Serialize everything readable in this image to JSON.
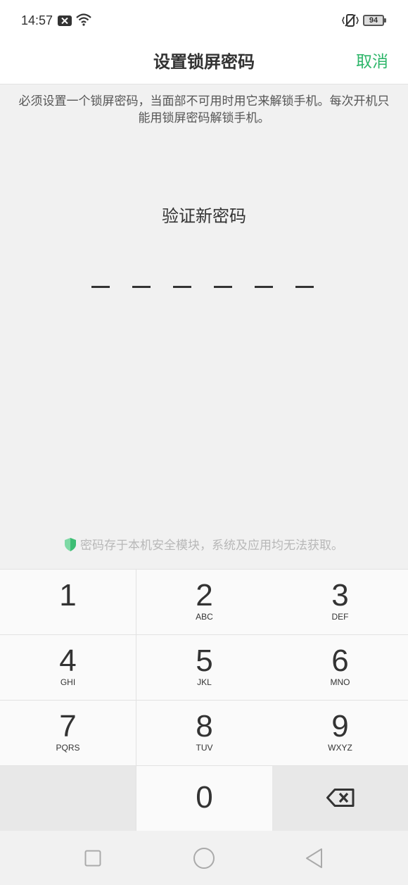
{
  "status_bar": {
    "time": "14:57",
    "battery": "94",
    "icons": [
      "notification-x-icon",
      "wifi-icon",
      "vibrate-icon",
      "battery-icon"
    ]
  },
  "header": {
    "title": "设置锁屏密码",
    "cancel_label": "取消",
    "accent_color": "#2eb66a"
  },
  "description": "必须设置一个锁屏密码，当面部不可用时用它来解锁手机。每次开机只能用锁屏密码解锁手机。",
  "prompt": "验证新密码",
  "pin": {
    "length": 6,
    "entered": 0
  },
  "secure_note": "密码存于本机安全模块，系统及应用均无法获取。",
  "keypad": {
    "keys": [
      {
        "digit": "1",
        "letters": ""
      },
      {
        "digit": "2",
        "letters": "ABC"
      },
      {
        "digit": "3",
        "letters": "DEF"
      },
      {
        "digit": "4",
        "letters": "GHI"
      },
      {
        "digit": "5",
        "letters": "JKL"
      },
      {
        "digit": "6",
        "letters": "MNO"
      },
      {
        "digit": "7",
        "letters": "PQRS"
      },
      {
        "digit": "8",
        "letters": "TUV"
      },
      {
        "digit": "9",
        "letters": "WXYZ"
      },
      {
        "digit": "0",
        "letters": ""
      }
    ],
    "backspace_icon": "backspace-icon"
  },
  "nav_bar": {
    "icons": [
      "recents-square-icon",
      "home-circle-icon",
      "back-triangle-icon"
    ]
  }
}
